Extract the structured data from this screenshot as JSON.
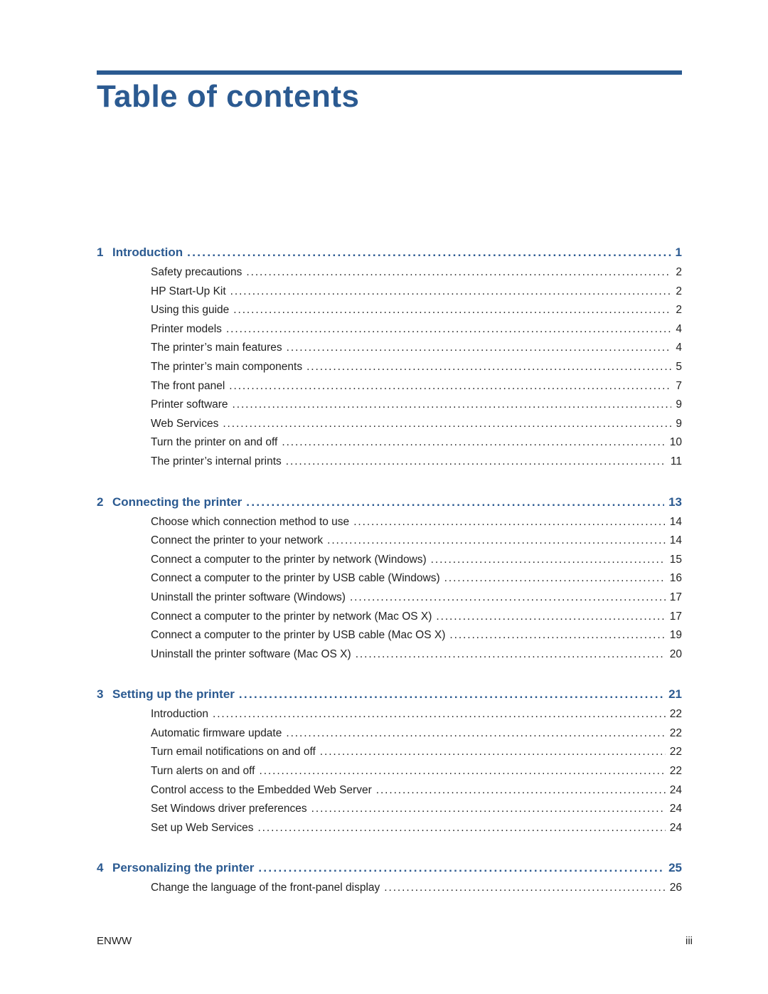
{
  "page": {
    "title": "Table of contents",
    "accent_color": "#2b5a91"
  },
  "chapters": [
    {
      "number": "1",
      "title": "Introduction",
      "page": "1",
      "sections": [
        {
          "title": "Safety precautions",
          "page": "2"
        },
        {
          "title": "HP Start-Up Kit",
          "page": "2"
        },
        {
          "title": "Using this guide",
          "page": "2"
        },
        {
          "title": "Printer models",
          "page": "4"
        },
        {
          "title": "The printer’s main features",
          "page": "4"
        },
        {
          "title": "The printer’s main components",
          "page": "5"
        },
        {
          "title": "The front panel",
          "page": "7"
        },
        {
          "title": "Printer software",
          "page": "9"
        },
        {
          "title": "Web Services",
          "page": "9"
        },
        {
          "title": "Turn the printer on and off",
          "page": "10"
        },
        {
          "title": "The printer’s internal prints",
          "page": "11"
        }
      ]
    },
    {
      "number": "2",
      "title": "Connecting the printer",
      "page": "13",
      "sections": [
        {
          "title": "Choose which connection method to use",
          "page": "14"
        },
        {
          "title": "Connect the printer to your network",
          "page": "14"
        },
        {
          "title": "Connect a computer to the printer by network (Windows)",
          "page": "15"
        },
        {
          "title": "Connect a computer to the printer by USB cable (Windows)",
          "page": "16"
        },
        {
          "title": "Uninstall the printer software (Windows)",
          "page": "17"
        },
        {
          "title": "Connect a computer to the printer by network (Mac OS X)",
          "page": "17"
        },
        {
          "title": "Connect a computer to the printer by USB cable (Mac OS X)",
          "page": "19"
        },
        {
          "title": "Uninstall the printer software (Mac OS X)",
          "page": "20"
        }
      ]
    },
    {
      "number": "3",
      "title": "Setting up the printer",
      "page": "21",
      "sections": [
        {
          "title": "Introduction",
          "page": "22"
        },
        {
          "title": "Automatic firmware update",
          "page": "22"
        },
        {
          "title": "Turn email notifications on and off",
          "page": "22"
        },
        {
          "title": "Turn alerts on and off",
          "page": "22"
        },
        {
          "title": "Control access to the Embedded Web Server",
          "page": "24"
        },
        {
          "title": "Set Windows driver preferences",
          "page": "24"
        },
        {
          "title": "Set up Web Services",
          "page": "24"
        }
      ]
    },
    {
      "number": "4",
      "title": "Personalizing the printer",
      "page": "25",
      "sections": [
        {
          "title": "Change the language of the front-panel display",
          "page": "26"
        }
      ]
    }
  ],
  "footer": {
    "left": "ENWW",
    "right": "iii"
  }
}
